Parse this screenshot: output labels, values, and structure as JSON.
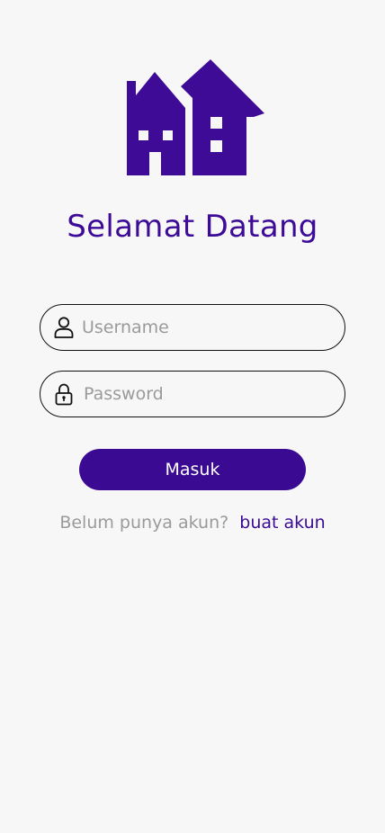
{
  "brand": {
    "logo_icon": "houses-logo-icon",
    "accent_color": "#3a0a92"
  },
  "login": {
    "title": "Selamat Datang",
    "username_field": {
      "icon": "user-icon",
      "placeholder": "Username",
      "value": ""
    },
    "password_field": {
      "icon": "lock-icon",
      "placeholder": "Password",
      "value": ""
    },
    "submit_label": "Masuk",
    "signup_prompt": "Belum punya akun?",
    "signup_link": "buat akun"
  }
}
